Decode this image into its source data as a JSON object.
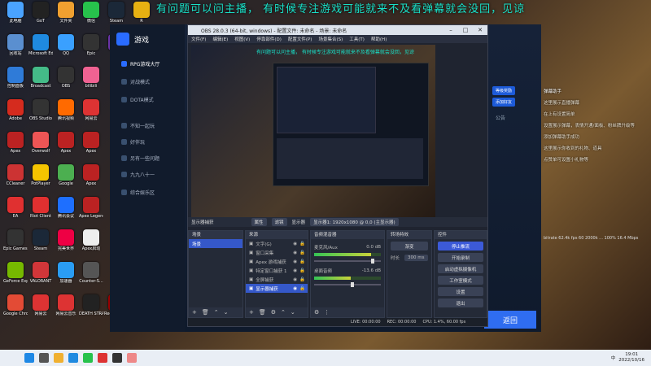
{
  "marquee": "有问题可以问主播，  有时候专注游戏可能就来不及看弹幕就会没回，见谅",
  "desktop_icons": [
    {
      "label": "此电脑",
      "color": "#4aa3ff"
    },
    {
      "label": "GoT",
      "color": "#222"
    },
    {
      "label": "文件夹",
      "color": "#f0a030"
    },
    {
      "label": "微信",
      "color": "#27c24c"
    },
    {
      "label": "Steam",
      "color": "#1b2838"
    },
    {
      "label": "R",
      "color": "#e6b012"
    },
    {
      "label": "回收站",
      "color": "#5a8fd0"
    },
    {
      "label": "Microsoft Edge",
      "color": "#1f8ae0"
    },
    {
      "label": "QQ",
      "color": "#3aa0ff"
    },
    {
      "label": "Epic",
      "color": "#333"
    },
    {
      "label": "Pr",
      "color": "#6a33a8"
    },
    {
      "label": "控制面板",
      "color": "#2f7bd8"
    },
    {
      "label": "Broadcast",
      "color": "#4b8"
    },
    {
      "label": "OBS",
      "color": "#333"
    },
    {
      "label": "bilibili",
      "color": "#f06292"
    },
    {
      "label": "Adobe",
      "color": "#d52b1e"
    },
    {
      "label": "OBS Studio",
      "color": "#333"
    },
    {
      "label": "腾讯视频",
      "color": "#ff6a00"
    },
    {
      "label": "网易云",
      "color": "#d33"
    },
    {
      "label": "Apex",
      "color": "#b22"
    },
    {
      "label": "Overwolf",
      "color": "#e55"
    },
    {
      "label": "Apex",
      "color": "#b22"
    },
    {
      "label": "Apex",
      "color": "#b22"
    },
    {
      "label": "CCleaner",
      "color": "#c33"
    },
    {
      "label": "PotPlayer",
      "color": "#f5c400"
    },
    {
      "label": "Google",
      "color": "#4caf50"
    },
    {
      "label": "Apex",
      "color": "#b22"
    },
    {
      "label": "EA",
      "color": "#e03030"
    },
    {
      "label": "Riot Client",
      "color": "#e03030"
    },
    {
      "label": "腾讯会议",
      "color": "#1e6fff"
    },
    {
      "label": "Apex Legends",
      "color": "#b22"
    },
    {
      "label": "Epic Games Launcher",
      "color": "#333"
    },
    {
      "label": "Steam",
      "color": "#1b2838"
    },
    {
      "label": "完美世界",
      "color": "#e04"
    },
    {
      "label": "Apex启动",
      "color": "#eee"
    },
    {
      "label": "GeForce Experience",
      "color": "#76b900"
    },
    {
      "label": "VALORANT",
      "color": "#d13639"
    },
    {
      "label": "加速器",
      "color": "#2a9df4"
    },
    {
      "label": "Counter-S...",
      "color": "#555"
    },
    {
      "label": "Google Chrome",
      "color": "#e34b35"
    },
    {
      "label": "网易云",
      "color": "#d33"
    },
    {
      "label": "网易云音乐",
      "color": "#d33"
    },
    {
      "label": "DEATH STRANDING",
      "color": "#222"
    },
    {
      "label": "Red Dead Redempti...",
      "color": "#900"
    },
    {
      "label": "Frame",
      "color": "#333"
    }
  ],
  "launcher": {
    "sidebar": [
      "RPG游戏大厅",
      "对战模式",
      "DOTA模式",
      "不知一起玩",
      "好伴玩",
      "另有一些问题",
      "九九八十一",
      "综合娱乐区"
    ],
    "right_buttons": [
      "等级奖励",
      "添加好友"
    ],
    "right_text": "公告",
    "start_label": "返回"
  },
  "chat": {
    "header": "弹幕助手",
    "lines": [
      "这里展示直播弹幕",
      "在上有设置简单",
      "设置展示弹幕，表情开通/面板、粉丝牌升级等",
      "添加弹幕助手成功",
      "这里展示你收到的礼物、道具",
      "点赞单可设置小礼物等"
    ]
  },
  "stats": "bitrate 62.4k  fps 60  2000k  ...  100% 16.4 Mbps",
  "obs": {
    "title": "OBS 28.0.3 (64-bit, windows) - 配置文件: 未命名 - 场景: 未命名",
    "menu": [
      "文件(F)",
      "编辑(E)",
      "视图(V)",
      "停靠部件(D)",
      "配置文件(P)",
      "场景集合(S)",
      "工具(T)",
      "帮助(H)"
    ],
    "preview_caption": "有问题可以问主播，   有时候专注游戏可能就来不及看弹幕就会没回，见谅",
    "previewbar": {
      "source": "显示器捕获",
      "props": "属性",
      "filter": "滤镜",
      "display": "显示器",
      "display_value": "显示器1: 1920x1080 @ 0,0 (主显示器)"
    },
    "scenes": {
      "title": "场景",
      "items": [
        "场景"
      ]
    },
    "sources": {
      "title": "来源",
      "items": [
        "文字(G)",
        "窗口采集",
        "Apex 游戏捕获",
        "特定窗口捕获 1",
        "全屏捕获",
        "显示器捕获"
      ]
    },
    "mixer": {
      "title": "音频混音器",
      "channels": [
        {
          "name": "麦克风/Aux",
          "db": "0.0 dB",
          "level": 0.85
        },
        {
          "name": "桌面音频",
          "db": "-13.6 dB",
          "level": 0.55
        }
      ]
    },
    "transitions": {
      "title": "转场特效",
      "type": "渐变",
      "duration_label": "时长",
      "duration": "300 ms"
    },
    "controls": {
      "title": "控件",
      "buttons": [
        "停止推流",
        "开始录制",
        "启动虚拟摄像机",
        "工作室模式",
        "设置",
        "退出"
      ]
    },
    "status": {
      "live": "LIVE: 00:00:00",
      "rec": "REC: 00:00:00",
      "cpu": "CPU: 1.4%, 60.00 fps"
    }
  },
  "taskbar": {
    "time": "19:01",
    "date": "2022/10/16",
    "ime": "中",
    "icons": [
      {
        "name": "start",
        "color": "#1e88e5"
      },
      {
        "name": "search",
        "color": "#555"
      },
      {
        "name": "explorer",
        "color": "#f0b030"
      },
      {
        "name": "edge",
        "color": "#1f8ae0"
      },
      {
        "name": "wechat",
        "color": "#27c24c"
      },
      {
        "name": "app",
        "color": "#d33"
      },
      {
        "name": "obs",
        "color": "#333"
      },
      {
        "name": "app2",
        "color": "#e88"
      }
    ]
  }
}
